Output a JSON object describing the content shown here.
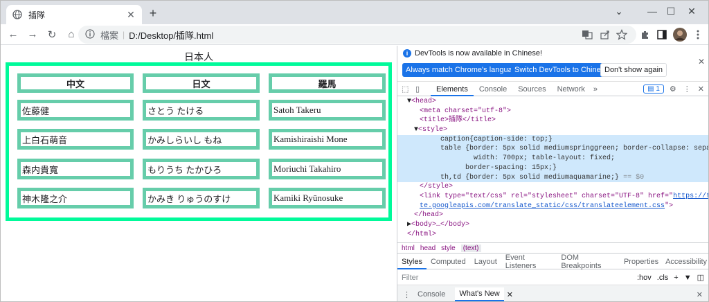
{
  "browser": {
    "tab_title": "插隊",
    "tab_close": "✕",
    "new_tab": "+",
    "address": {
      "badge": "檔案",
      "url": "D:/Desktop/插隊.html"
    }
  },
  "page": {
    "caption": "日本人",
    "headers": [
      "中文",
      "日文",
      "羅馬"
    ],
    "rows": [
      [
        "佐藤健",
        "さとう たける",
        "Satoh Takeru"
      ],
      [
        "上白石萌音",
        "かみしらいし もね",
        "Kamishiraishi Mone"
      ],
      [
        "森内貴寬",
        "もりうち たかひろ",
        "Moriuchi Takahiro"
      ],
      [
        "神木隆之介",
        "かみき りゅうのすけ",
        "Kamiki Ryūnosuke"
      ]
    ]
  },
  "devtools": {
    "notice": "DevTools is now available in Chinese!",
    "btn_match": "Always match Chrome's language",
    "btn_switch": "Switch DevTools to Chinese",
    "btn_dismiss": "Don't show again",
    "tabs": [
      "Elements",
      "Console",
      "Sources",
      "Network"
    ],
    "issues_count": "1",
    "code": {
      "head": "<head>",
      "meta": "<meta charset=\"utf-8\">",
      "title": "<title>插隊</title>",
      "style": "<style>",
      "css1": "caption{caption-side: top;}",
      "css2": "table {border: 5px solid mediumspringgreen; border-collapse: separate;",
      "css3": "width: 700px; table-layout: fixed;",
      "css4": "border-spacing: 15px;}",
      "css5": "th,td {border: 5px solid mediumaquamarine;}",
      "css5b": "== $0",
      "style_end": "</style>",
      "link1": "<link type=\"text/css\" rel=\"stylesheet\" charset=\"UTF-8\" href=\"",
      "link_url1": "https://transla",
      "link_url2": "te.googleapis.com/translate_static/css/translateelement.css",
      "link_end": "\">",
      "head_end": "</head>",
      "body": "<body>…</body>",
      "html_end": "</html>"
    },
    "breadcrumbs": [
      "html",
      "head",
      "style",
      "(text)"
    ],
    "subtabs": [
      "Styles",
      "Computed",
      "Layout",
      "Event Listeners",
      "DOM Breakpoints",
      "Properties",
      "Accessibility"
    ],
    "filter_placeholder": "Filter",
    "filter_hov": ":hov",
    "filter_cls": ".cls",
    "drawer_tabs": [
      "Console",
      "What's New"
    ]
  },
  "colors": {
    "table_border": "#00fa9a",
    "cell_border": "#66cdaa",
    "accent": "#1a73e8"
  }
}
